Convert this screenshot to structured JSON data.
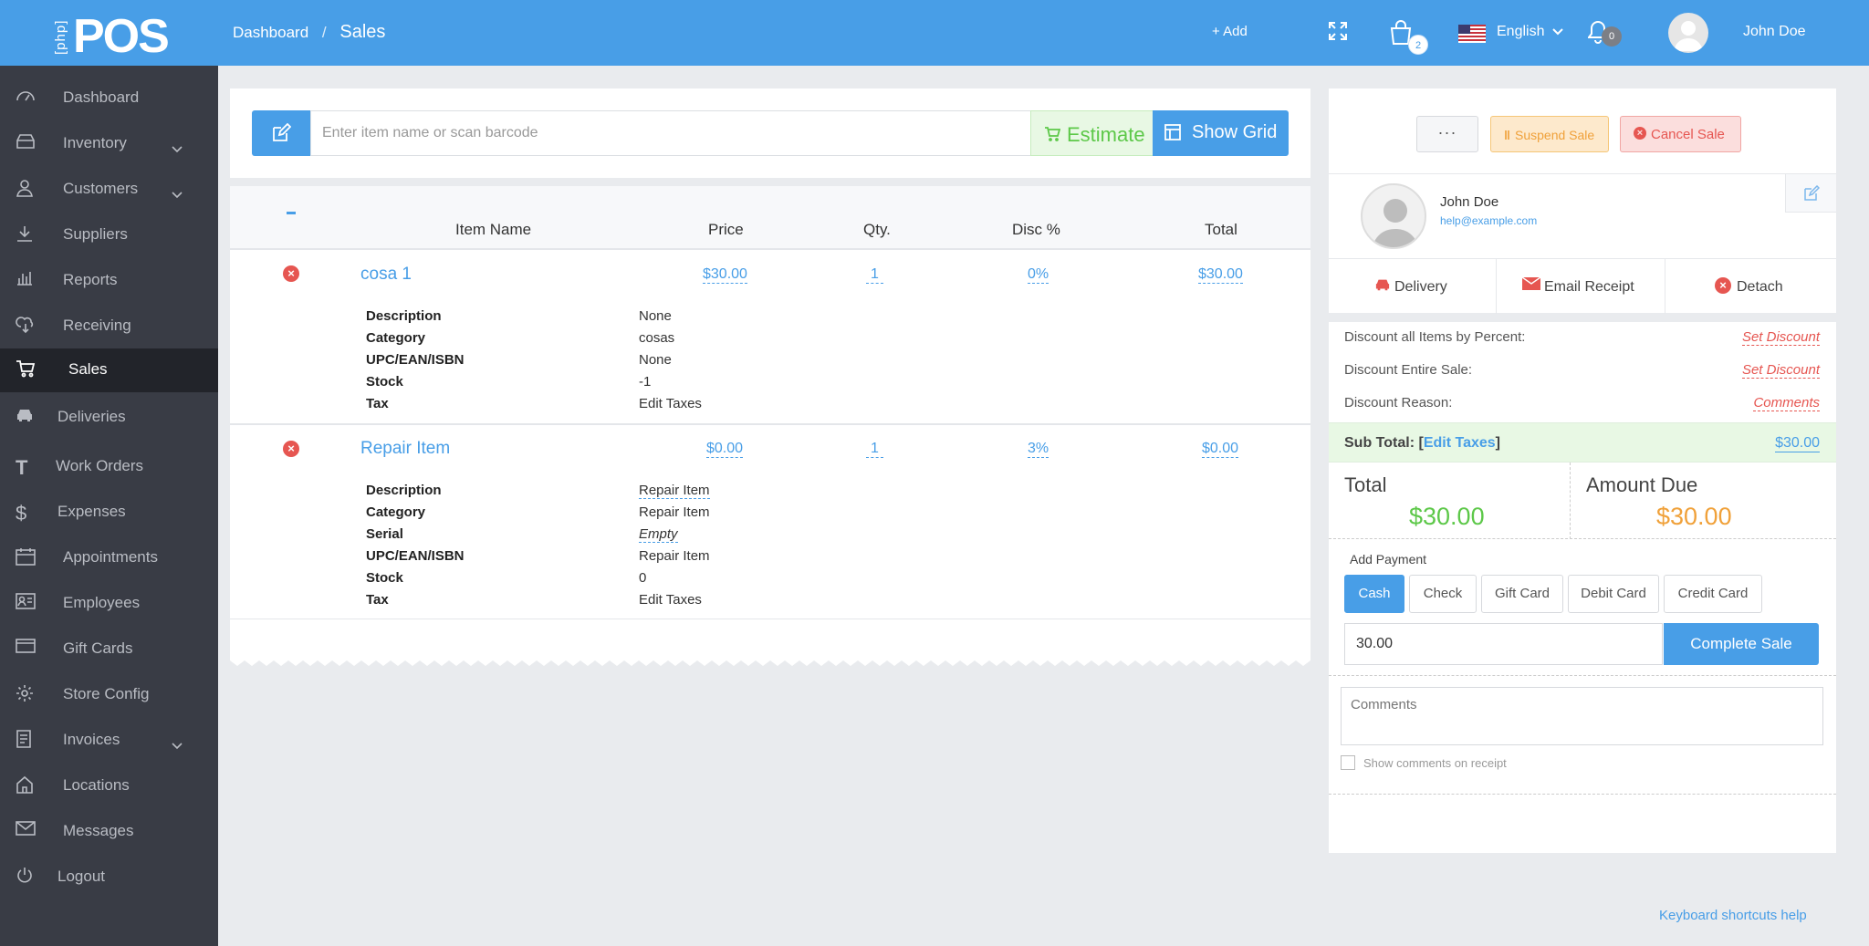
{
  "topbar": {
    "logo_php": "[php]",
    "logo_pos": "POS",
    "breadcrumb_home": "Dashboard",
    "breadcrumb_sep": "/",
    "breadcrumb_current": "Sales",
    "add_label": "+ Add",
    "cart_count": "2",
    "language": "English",
    "notifications_count": "0",
    "user_name": "John Doe"
  },
  "sidebar": {
    "items": [
      {
        "label": "Dashboard",
        "icon": "dashboard-icon"
      },
      {
        "label": "Inventory",
        "icon": "inventory-icon",
        "has_children": true
      },
      {
        "label": "Customers",
        "icon": "customers-icon",
        "has_children": true
      },
      {
        "label": "Suppliers",
        "icon": "suppliers-icon"
      },
      {
        "label": "Reports",
        "icon": "reports-icon"
      },
      {
        "label": "Receiving",
        "icon": "receiving-icon"
      },
      {
        "label": "Sales",
        "icon": "sales-icon",
        "active": true
      },
      {
        "label": "Deliveries",
        "icon": "deliveries-icon"
      },
      {
        "label": "Work Orders",
        "icon": "work-orders-icon"
      },
      {
        "label": "Expenses",
        "icon": "expenses-icon"
      },
      {
        "label": "Appointments",
        "icon": "appointments-icon"
      },
      {
        "label": "Employees",
        "icon": "employees-icon"
      },
      {
        "label": "Gift Cards",
        "icon": "gift-cards-icon"
      },
      {
        "label": "Store Config",
        "icon": "store-config-icon"
      },
      {
        "label": "Invoices",
        "icon": "invoices-icon",
        "has_children": true
      },
      {
        "label": "Locations",
        "icon": "locations-icon"
      },
      {
        "label": "Messages",
        "icon": "messages-icon"
      },
      {
        "label": "Logout",
        "icon": "logout-icon"
      }
    ]
  },
  "search": {
    "placeholder": "Enter item name or scan barcode",
    "estimate_label": "Estimate",
    "show_grid_label": "Show Grid"
  },
  "cart": {
    "headers": {
      "item_name": "Item Name",
      "price": "Price",
      "qty": "Qty.",
      "disc": "Disc %",
      "total": "Total"
    },
    "items": [
      {
        "name": "cosa 1",
        "price": "$30.00",
        "qty": "1",
        "disc": "0%",
        "total": "$30.00",
        "details": [
          {
            "label": "Description",
            "value": "None"
          },
          {
            "label": "Category",
            "value": "cosas"
          },
          {
            "label": "UPC/EAN/ISBN",
            "value": "None"
          },
          {
            "label": "Stock",
            "value": "-1"
          },
          {
            "label": "Tax",
            "value": "Edit Taxes"
          }
        ]
      },
      {
        "name": "Repair Item",
        "price": "$0.00",
        "qty": "1",
        "disc": "3%",
        "total": "$0.00",
        "details": [
          {
            "label": "Description",
            "value": "Repair Item"
          },
          {
            "label": "Category",
            "value": "Repair Item"
          },
          {
            "label": "Serial",
            "value": "Empty"
          },
          {
            "label": "UPC/EAN/ISBN",
            "value": "Repair Item"
          },
          {
            "label": "Stock",
            "value": "0"
          },
          {
            "label": "Tax",
            "value": "Edit Taxes"
          }
        ]
      }
    ]
  },
  "register": {
    "more_label": "···",
    "suspend_label": "Suspend Sale",
    "cancel_label": "Cancel Sale",
    "customer_name": "John Doe",
    "customer_email": "help@example.com",
    "delivery_label": "Delivery",
    "email_receipt_label": "Email Receipt",
    "detach_label": "Detach",
    "discount_percent_label": "Discount all Items by Percent:",
    "discount_entire_label": "Discount Entire Sale:",
    "discount_reason_label": "Discount Reason:",
    "set_discount_label": "Set Discount",
    "comments_link": "Comments",
    "subtotal_label": "Sub Total:",
    "edit_taxes_label": "Edit Taxes",
    "subtotal_value": "$30.00",
    "total_label": "Total",
    "total_value": "$30.00",
    "amount_due_label": "Amount Due",
    "amount_due_value": "$30.00",
    "add_payment_label": "Add Payment",
    "payment_types": [
      "Cash",
      "Check",
      "Gift Card",
      "Debit Card",
      "Credit Card"
    ],
    "payment_amount": "30.00",
    "complete_label": "Complete Sale",
    "comments_placeholder": "Comments",
    "show_comments_label": "Show comments on receipt"
  },
  "footer": {
    "keyboard_help": "Keyboard shortcuts help"
  },
  "colors": {
    "brand_blue": "#489ee7",
    "sidebar_bg": "#393c45",
    "sidebar_active": "#22242a",
    "total_green": "#5dc849",
    "due_orange": "#f0a13a",
    "danger_red": "#e65651"
  }
}
